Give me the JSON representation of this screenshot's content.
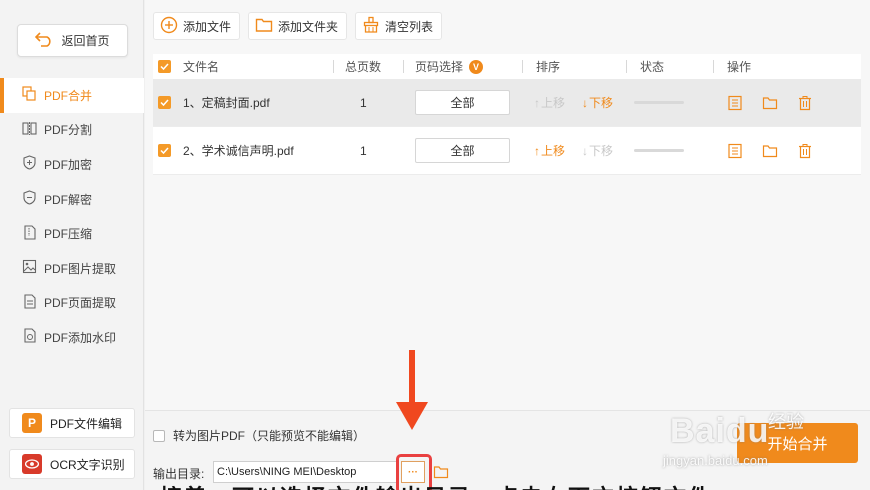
{
  "sidebar": {
    "back_label": "返回首页",
    "items": [
      {
        "label": "PDF合并",
        "icon": "merge-icon",
        "active": true
      },
      {
        "label": "PDF分割",
        "icon": "split-icon"
      },
      {
        "label": "PDF加密",
        "icon": "lock-shield-icon"
      },
      {
        "label": "PDF解密",
        "icon": "unlock-shield-icon"
      },
      {
        "label": "PDF压缩",
        "icon": "compress-icon"
      },
      {
        "label": "PDF图片提取",
        "icon": "image-extract-icon"
      },
      {
        "label": "PDF页面提取",
        "icon": "page-extract-icon"
      },
      {
        "label": "PDF添加水印",
        "icon": "watermark-icon"
      }
    ],
    "promos": [
      {
        "label": "PDF文件编辑",
        "logo": "P",
        "color": "#f08a1c"
      },
      {
        "label": "OCR文字识别",
        "logo": "eye",
        "color": "#d83a2a"
      }
    ]
  },
  "toolbar": {
    "add_file": "添加文件",
    "add_folder": "添加文件夹",
    "clear_list": "清空列表"
  },
  "table": {
    "headers": {
      "name": "文件名",
      "pages": "总页数",
      "page_select": "页码选择",
      "sort": "排序",
      "status": "状态",
      "actions": "操作"
    },
    "rows": [
      {
        "name": "1、定稿封面.pdf",
        "pages": "1",
        "page_select": "全部",
        "up": "上移",
        "down": "下移",
        "up_enabled": false,
        "down_enabled": true
      },
      {
        "name": "2、学术诚信声明.pdf",
        "pages": "1",
        "page_select": "全部",
        "up": "上移",
        "down": "下移",
        "up_enabled": true,
        "down_enabled": false
      }
    ]
  },
  "bottom": {
    "image_option": "转为图片PDF（只能预览不能编辑）",
    "output_label": "输出目录:",
    "output_path": "C:\\Users\\NING MEI\\Desktop",
    "browse": "···",
    "start": "开始合并"
  },
  "overlay": {
    "watermark_brand": "Baidu",
    "watermark_cn": "经验",
    "watermark_url": "jingyan.baidu.com",
    "caption": "接着，可以选择文件输出目录，点击右下方按钮文件"
  },
  "colors": {
    "accent": "#f08a1c",
    "highlight": "#e94040"
  }
}
